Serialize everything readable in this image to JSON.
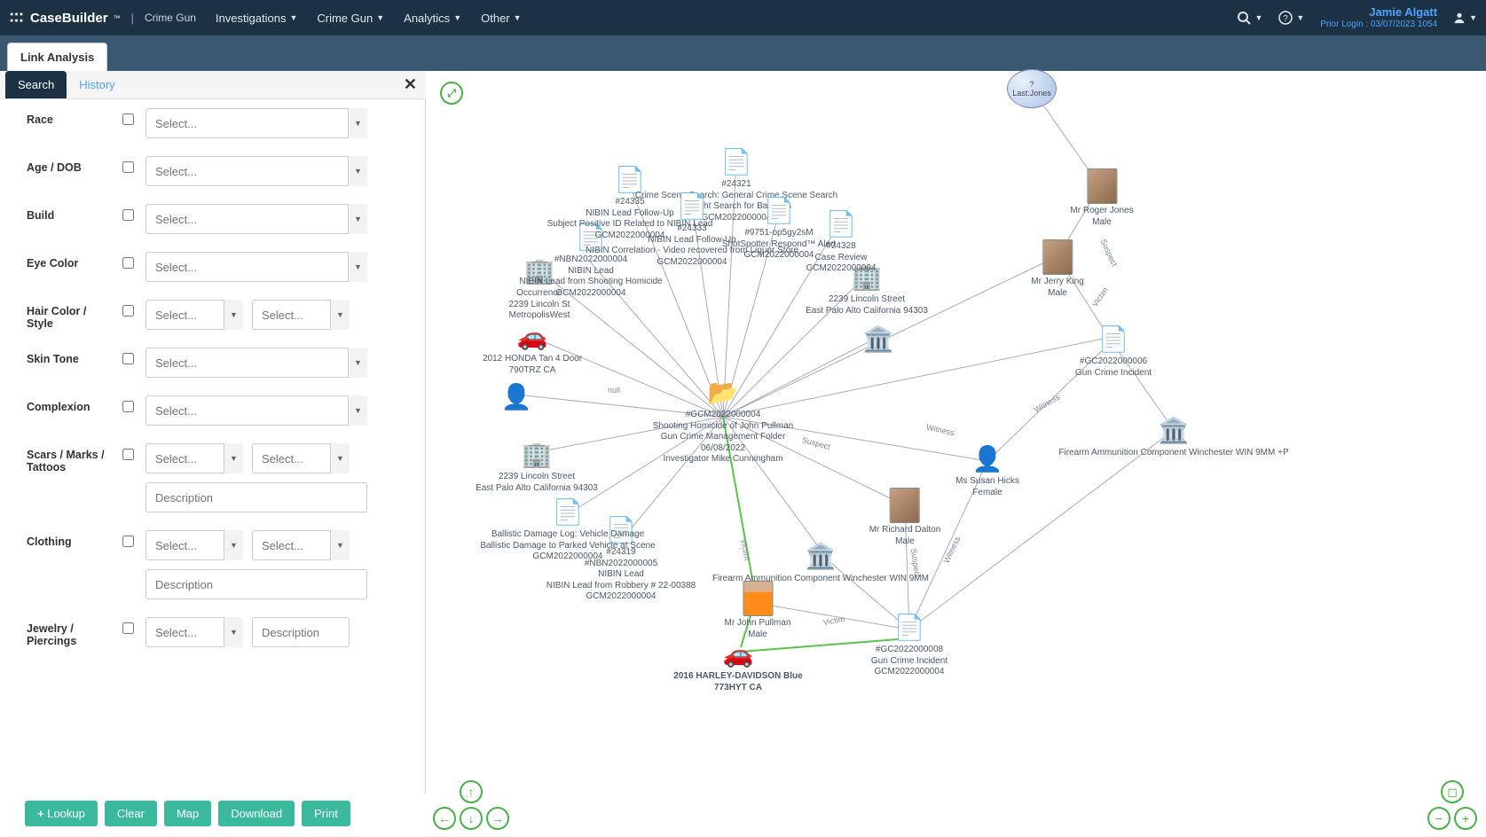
{
  "header": {
    "brand": "CaseBuilder",
    "tm": "™",
    "divider": "|",
    "sub": "Crime Gun",
    "nav": [
      "Investigations",
      "Crime Gun",
      "Analytics",
      "Other"
    ],
    "user_name": "Jamie Algatt",
    "prior_login": "Prior Login : 03/07/2023 1054"
  },
  "subheader": {
    "tab": "Link Analysis"
  },
  "sidebar": {
    "tab_search": "Search",
    "tab_history": "History",
    "fields": {
      "race": "Race",
      "age": "Age / DOB",
      "build": "Build",
      "eye": "Eye Color",
      "hair": "Hair Color / Style",
      "skin": "Skin Tone",
      "complexion": "Complexion",
      "scars": "Scars / Marks / Tattoos",
      "clothing": "Clothing",
      "jewelry": "Jewelry / Piercings"
    },
    "select_placeholder": "Select...",
    "desc_placeholder": "Description",
    "buttons": {
      "lookup": "Lookup",
      "clear": "Clear",
      "map": "Map",
      "download": "Download",
      "print": "Print"
    }
  },
  "graph": {
    "query_node": {
      "q": "?",
      "label": "Last:Jones"
    },
    "center": {
      "id": "#GCM2022000004",
      "name": "Shooting Homicide of John Pullman",
      "type": "Gun Crime Management Folder",
      "date": "06/08/2022",
      "inv": "Investigator Mike Cunningham"
    },
    "nodes": {
      "roger": {
        "name": "Mr Roger  Jones",
        "sub": "Male"
      },
      "jerry": {
        "name": "Mr Jerry  King",
        "sub": "Male"
      },
      "susan": {
        "name": "Ms Susan  Hicks",
        "sub": "Female"
      },
      "richard": {
        "name": "Mr Richard  Dalton",
        "sub": "Male"
      },
      "john": {
        "name": "Mr John  Pullman",
        "sub": "Male"
      },
      "gc6": {
        "id": "#GC2022000006",
        "sub": "Gun Crime Incident"
      },
      "gc8": {
        "id": "#GC2022000008",
        "sub": "Gun Crime Incident",
        "sub2": "GCM2022000004"
      },
      "ammo1": "Firearm Ammunition Component Winchester WIN 9MM +P",
      "ammo2": "Firearm Ammunition Component Winchester WIN 9MM",
      "harley": {
        "l1": "2016 HARLEY-DAVIDSON Blue",
        "l2": "773HYT CA"
      },
      "honda": {
        "l1": "2012 HONDA Tan 4 Door",
        "l2": "790TRZ CA"
      },
      "addr1": {
        "l1": "2239 Lincoln Street",
        "l2": "East Palo Alto California 94303"
      },
      "addr2": {
        "l1": "2239 Lincoln Street",
        "l2": "East Palo Alto California 94303"
      },
      "occ": {
        "l1": "Occurrence",
        "l2": "2239 Lincoln St",
        "l3": "MetropolisWest"
      },
      "nb4a": {
        "id": "#NBN2022000004",
        "l1": "NIBIN Lead",
        "l2": "NIBIN Lead from Shooting Homicide",
        "l3": "GCM2022000004"
      },
      "nb5": {
        "id": "#NBN2022000005",
        "l1": "NIBIN Lead",
        "l2": "NIBIN Lead from Robbery # 22-00388",
        "l3": "GCM2022000004"
      },
      "ball": {
        "l1": "Ballistic Damage Log: Vehicle Damage",
        "l2": "Ballistic Damage to Parked Vehicle at Scene",
        "l3": "GCM2022000004"
      },
      "t24335": {
        "id": "#24335",
        "l1": "NIBIN Lead Follow-Up",
        "l2": "Subject Positive ID Related to NIBIN Lead",
        "l3": "GCM2022000004"
      },
      "t24321": {
        "id": "#24321",
        "l1": "Crime Scene Search: General Crime Scene Search",
        "l2": "Twilight Search for Ballistics",
        "l3": "GCM2022000004"
      },
      "t24333": {
        "id": "#24333",
        "l1": "NIBIN Lead Follow-Up",
        "l2": "NIBIN Correlation - Video recovered from Liquor Store",
        "l3": "GCM2022000004"
      },
      "t9751": {
        "id": "#9751-op5gy2sM",
        "l1": "ShotSpotter Respond™ Alert",
        "l2": "GCM2022000004"
      },
      "t24328": {
        "id": "#24328",
        "l1": "Case Review",
        "l2": "GCM2022000004"
      },
      "t24319": {
        "id": "#24319"
      }
    },
    "edges": {
      "null": "null",
      "witness": "Witness",
      "suspect": "Suspect",
      "victim": "Victim"
    }
  }
}
